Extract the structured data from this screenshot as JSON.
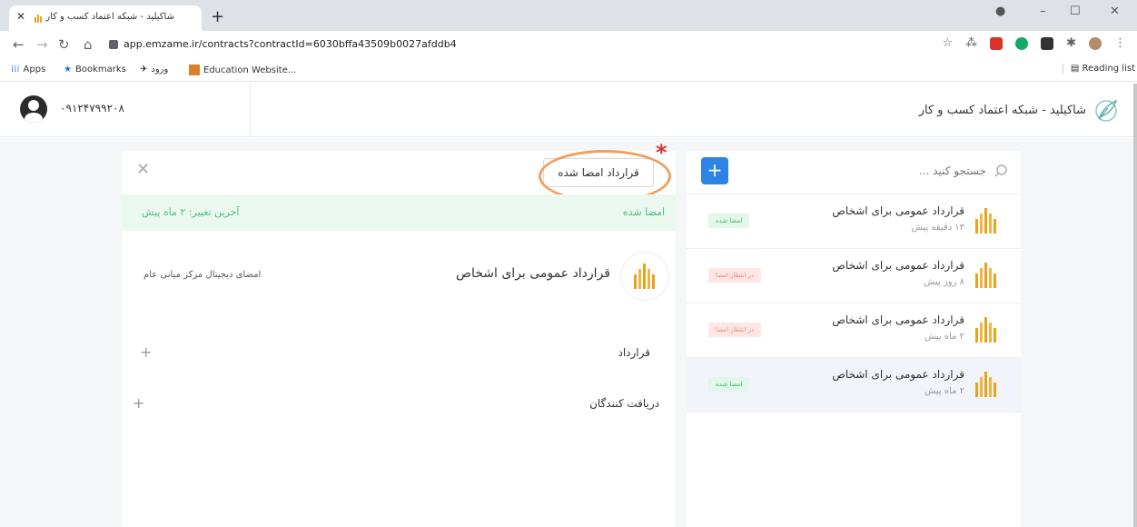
{
  "browser": {
    "tab_title": "شاکیلید - شبکه اعتماد کسب و کار",
    "tab_close": "✕",
    "new_tab": "+",
    "url": "app.emzame.ir/contracts?contractId=6030bffa43509b0027afddb4",
    "window_controls": [
      "–",
      "☐",
      "✕"
    ],
    "bookmarks": [
      "Apps",
      "Bookmarks",
      "ورود",
      "Education Website..."
    ],
    "reading_list": "Reading list"
  },
  "header": {
    "phone": "۰۹۱۲۴۷۹۹۲۰۸",
    "brand_name": "شاکیلید - شبکه اعتماد کسب و کار"
  },
  "detail": {
    "close": "✕",
    "signed_button": "قرارداد امضا شده",
    "annotation_star": "*",
    "status_label": "امضا شده",
    "last_change": "آخرین تغییر: ۲ ماه پیش",
    "doc_title": "قرارداد عمومی برای اشخاص",
    "signature_type": "امضای دیجیتال مرکز میانی عام",
    "sections": [
      {
        "label": "قرارداد",
        "icon": "+"
      },
      {
        "label": "دریافت کنندگان",
        "icon": "+"
      }
    ]
  },
  "list": {
    "add_button": "+",
    "search_placeholder": "جستجو کنید ...",
    "items": [
      {
        "title": "قرارداد عمومی برای اشخاص",
        "time": "۱۳ دقیقه پیش",
        "badge": "امضا شده",
        "badge_color": "#48b87a"
      },
      {
        "title": "قرارداد عمومی برای اشخاص",
        "time": "۸ روز پیش",
        "badge": "در انتظار امضا",
        "badge_color": "#f08878"
      },
      {
        "title": "قرارداد عمومی برای اشخاص",
        "time": "۲ ماه پیش",
        "badge": "در انتظار امضا",
        "badge_color": "#f08878"
      },
      {
        "title": "قرارداد عمومی برای اشخاص",
        "time": "۲ ماه پیش",
        "badge": "امضا شده",
        "badge_color": "#48b87a"
      }
    ]
  },
  "colors": {
    "accent": "#2d84e4",
    "signed_green": "#48b87a",
    "pending_red": "#f08878",
    "highlight_orange": "#f0a061",
    "logo_gold": "#e9a21c"
  }
}
